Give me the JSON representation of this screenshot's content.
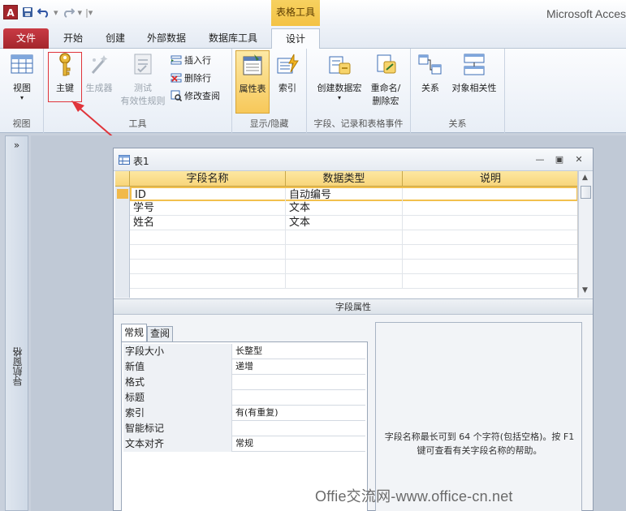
{
  "titlebar": {
    "app_icon_letter": "A",
    "title": "Microsoft Acces",
    "context_group": "表格工具"
  },
  "tabs": [
    {
      "label": "文件"
    },
    {
      "label": "开始"
    },
    {
      "label": "创建"
    },
    {
      "label": "外部数据"
    },
    {
      "label": "数据库工具"
    },
    {
      "label": "设计"
    }
  ],
  "ribbon": {
    "view": {
      "label": "视图",
      "group": "视图"
    },
    "tools": {
      "group": "工具",
      "primary_key": "主键",
      "builder": "生成器",
      "test_rules_1": "测试",
      "test_rules_2": "有效性规则",
      "insert_rows": "插入行",
      "delete_rows": "删除行",
      "modify_lookup": "修改查阅"
    },
    "show_hide": {
      "group": "显示/隐藏",
      "property_sheet": "属性表",
      "indexes": "索引"
    },
    "field_events": {
      "group": "字段、记录和表格事件",
      "create_macro": "创建数据宏",
      "rename_macro_1": "重命名/",
      "rename_macro_2": "删除宏"
    },
    "relationships": {
      "group": "关系",
      "relations": "关系",
      "dependencies": "对象相关性"
    }
  },
  "navpane": {
    "toggle": "»",
    "label": "导航窗格"
  },
  "document": {
    "title": "表1",
    "columns": [
      "字段名称",
      "数据类型",
      "说明"
    ],
    "rows": [
      {
        "name": "ID",
        "type": "自动编号",
        "desc": ""
      },
      {
        "name": "学号",
        "type": "文本",
        "desc": ""
      },
      {
        "name": "姓名",
        "type": "文本",
        "desc": ""
      }
    ],
    "field_properties_label": "字段属性",
    "prop_tabs": [
      "常规",
      "查阅"
    ],
    "properties": [
      {
        "key": "字段大小",
        "value": "长整型"
      },
      {
        "key": "新值",
        "value": "递增"
      },
      {
        "key": "格式",
        "value": ""
      },
      {
        "key": "标题",
        "value": ""
      },
      {
        "key": "索引",
        "value": "有(有重复)"
      },
      {
        "key": "智能标记",
        "value": ""
      },
      {
        "key": "文本对齐",
        "value": "常规"
      }
    ],
    "help_text": "字段名称最长可到 64 个字符(包括空格)。按 F1 键可查看有关字段名称的帮助。"
  },
  "watermark": "Offie交流网-www.office-cn.net",
  "colors": {
    "accent_red": "#a4262c",
    "context_yellow": "#f3c244",
    "annotation_red": "#e0343a"
  }
}
